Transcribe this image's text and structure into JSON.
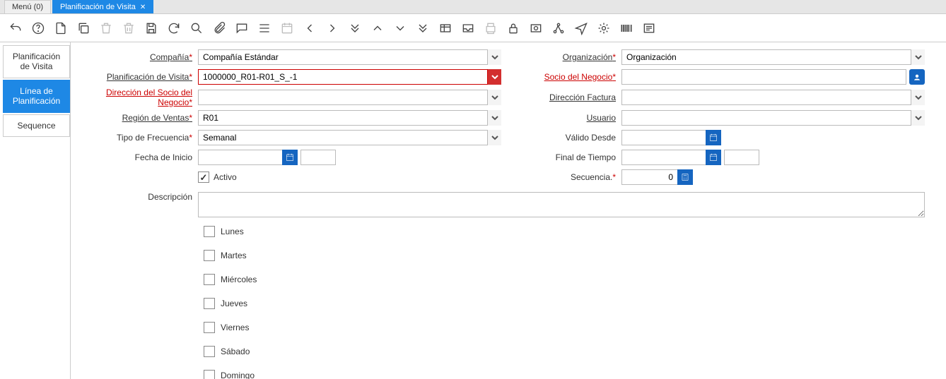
{
  "tabs": {
    "menu": "Menú (0)",
    "active": "Planificación de Visita"
  },
  "toolbar_icons": [
    "undo-icon",
    "help-icon",
    "new-icon",
    "copy-icon",
    "delete-icon",
    "trash-icon",
    "save-icon",
    "refresh-icon",
    "search-icon",
    "attach-icon",
    "chat-icon",
    "list-icon",
    "calendar-icon",
    "prev-icon",
    "next-icon",
    "first-icon",
    "up-icon",
    "down-icon",
    "last-icon",
    "grid-icon",
    "inbox-icon",
    "print-icon",
    "lock-icon",
    "scan-icon",
    "flow-icon",
    "send-icon",
    "gear-icon",
    "barcode-icon",
    "form-icon"
  ],
  "nav": {
    "items": [
      {
        "label": "Planificación de Visita"
      },
      {
        "label": "Línea de Planificación"
      },
      {
        "label": "Sequence"
      }
    ]
  },
  "form": {
    "compania": {
      "label": "Compañía",
      "value": "Compañía Estándar"
    },
    "organizacion": {
      "label": "Organización",
      "value": "Organización"
    },
    "plan_visita": {
      "label": "Planificación de Visita",
      "value": "1000000_R01-R01_S_-1"
    },
    "socio": {
      "label": "Socio del Negocio",
      "value": ""
    },
    "direccion_socio": {
      "label": "Dirección del Socio del Negocio",
      "value": ""
    },
    "direccion_factura": {
      "label": "Dirección Factura",
      "value": ""
    },
    "region": {
      "label": "Región de Ventas",
      "value": "R01"
    },
    "usuario": {
      "label": "Usuario",
      "value": ""
    },
    "tipo_frecuencia": {
      "label": "Tipo de Frecuencia",
      "value": "Semanal"
    },
    "valido_desde": {
      "label": "Válido Desde",
      "value": ""
    },
    "fecha_inicio": {
      "label": "Fecha de Inicio",
      "value": "",
      "time": ""
    },
    "final_tiempo": {
      "label": "Final de Tiempo",
      "value": "",
      "time": ""
    },
    "activo": {
      "label": "Activo",
      "checked": true
    },
    "secuencia": {
      "label": "Secuencia.",
      "value": "0"
    },
    "descripcion": {
      "label": "Descripción",
      "value": ""
    },
    "days": {
      "lunes": "Lunes",
      "martes": "Martes",
      "miercoles": "Miércoles",
      "jueves": "Jueves",
      "viernes": "Viernes",
      "sabado": "Sábado",
      "domingo": "Domingo"
    }
  }
}
